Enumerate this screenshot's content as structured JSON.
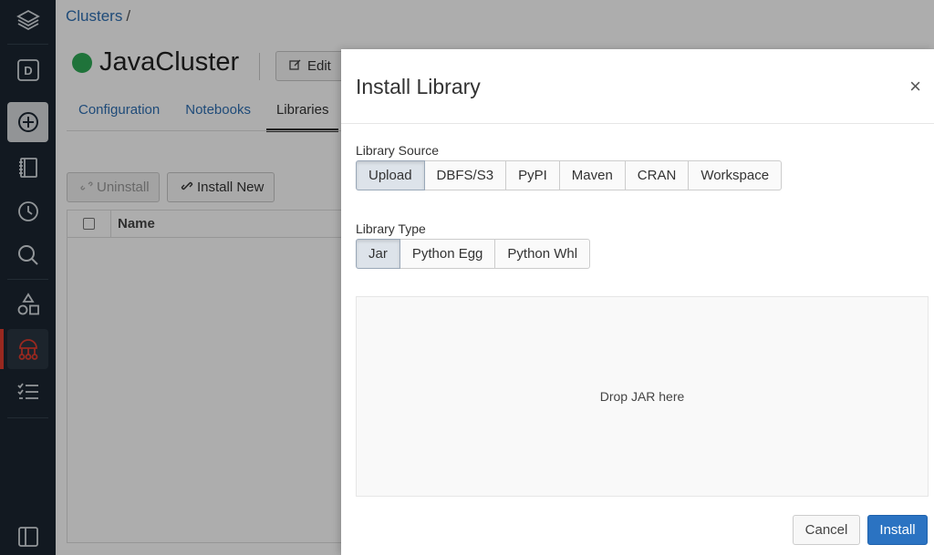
{
  "breadcrumb": {
    "root": "Clusters",
    "separator": "/"
  },
  "cluster": {
    "name": "JavaCluster",
    "status_color": "#2eaa56",
    "edit_label": "Edit"
  },
  "tabs": [
    {
      "label": "Configuration"
    },
    {
      "label": "Notebooks"
    },
    {
      "label": "Libraries",
      "active": true
    }
  ],
  "toolbar": {
    "uninstall_label": "Uninstall",
    "install_new_label": "Install New"
  },
  "library_table": {
    "columns": [
      "Name"
    ]
  },
  "sidebar": {
    "items": [
      {
        "icon": "layers-icon"
      },
      {
        "icon": "d-icon"
      },
      {
        "icon": "plus-circle-icon"
      },
      {
        "icon": "notebook-icon"
      },
      {
        "icon": "clock-icon"
      },
      {
        "icon": "search-icon"
      },
      {
        "icon": "shapes-icon"
      },
      {
        "icon": "cluster-icon",
        "active": true
      },
      {
        "icon": "jobs-list-icon"
      },
      {
        "icon": "sidebar-toggle-icon"
      }
    ]
  },
  "modal": {
    "title": "Install Library",
    "close": "×",
    "library_source": {
      "label": "Library Source",
      "options": [
        "Upload",
        "DBFS/S3",
        "PyPI",
        "Maven",
        "CRAN",
        "Workspace"
      ],
      "selected": "Upload"
    },
    "library_type": {
      "label": "Library Type",
      "options": [
        "Jar",
        "Python Egg",
        "Python Whl"
      ],
      "selected": "Jar"
    },
    "dropzone_text": "Drop JAR here",
    "cancel_label": "Cancel",
    "install_label": "Install"
  },
  "colors": {
    "accent": "#2b73c2",
    "sidebar": "#1b2631",
    "active_red": "#e03b2f"
  }
}
